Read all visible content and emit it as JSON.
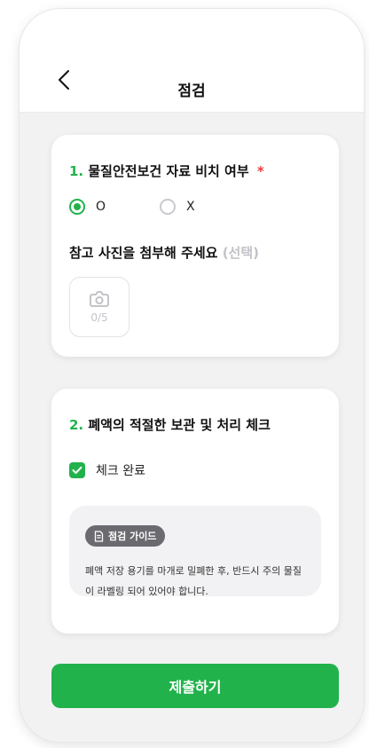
{
  "header": {
    "title": "점검",
    "back_icon": "chevron-left-icon"
  },
  "question1": {
    "number": "1.",
    "title": "물질안전보건 자료 비치 여부",
    "required_mark": "*",
    "options": [
      {
        "label": "O",
        "selected": true
      },
      {
        "label": "X",
        "selected": false
      }
    ],
    "photo_label": "참고 사진을 첨부해 주세요",
    "photo_optional": "(선택)",
    "photo_icon": "camera-icon",
    "photo_count": "0/5"
  },
  "question2": {
    "number": "2.",
    "title": "폐액의 적절한 보관 및 처리 체크",
    "checkbox_label": "체크 완료",
    "checkbox_checked": true,
    "guide": {
      "icon": "document-icon",
      "label": "점검 가이드",
      "text": "폐액 저장 용기를 마개로 밀폐한 후, 반드시 주의 물질이 라벨링 되어 있어야 합니다."
    }
  },
  "submit_label": "제출하기",
  "colors": {
    "accent": "#22b24c",
    "required": "#ef3b3b",
    "background": "#f2f2f3"
  }
}
